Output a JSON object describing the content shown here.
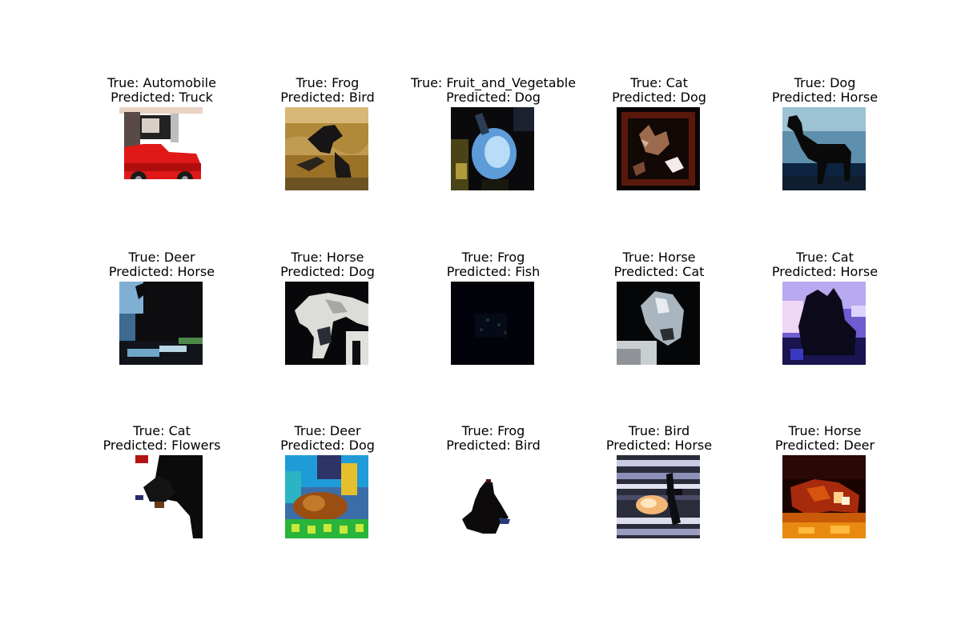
{
  "figure": {
    "panels": [
      {
        "true_label": "True: Automobile",
        "predicted_label": "Predicted: Truck",
        "thumbnail": "red-car-icon"
      },
      {
        "true_label": "True: Frog",
        "predicted_label": "Predicted: Bird",
        "thumbnail": "frog-on-ground-icon"
      },
      {
        "true_label": "True: Fruit_and_Vegetable",
        "predicted_label": "Predicted: Dog",
        "thumbnail": "blue-fruit-icon"
      },
      {
        "true_label": "True: Cat",
        "predicted_label": "Predicted: Dog",
        "thumbnail": "cat-in-frame-icon"
      },
      {
        "true_label": "True: Dog",
        "predicted_label": "Predicted: Horse",
        "thumbnail": "dog-silhouette-icon"
      },
      {
        "true_label": "True: Deer",
        "predicted_label": "Predicted: Horse",
        "thumbnail": "dark-deer-icon"
      },
      {
        "true_label": "True: Horse",
        "predicted_label": "Predicted: Dog",
        "thumbnail": "white-horse-icon"
      },
      {
        "true_label": "True: Frog",
        "predicted_label": "Predicted: Fish",
        "thumbnail": "dark-frog-icon"
      },
      {
        "true_label": "True: Horse",
        "predicted_label": "Predicted: Cat",
        "thumbnail": "horse-head-icon"
      },
      {
        "true_label": "True: Cat",
        "predicted_label": "Predicted: Horse",
        "thumbnail": "cat-purple-icon"
      },
      {
        "true_label": "True: Cat",
        "predicted_label": "Predicted: Flowers",
        "thumbnail": "black-cat-white-icon"
      },
      {
        "true_label": "True: Deer",
        "predicted_label": "Predicted: Dog",
        "thumbnail": "deer-colorful-icon"
      },
      {
        "true_label": "True: Frog",
        "predicted_label": "Predicted: Bird",
        "thumbnail": "frog-silhouette-icon"
      },
      {
        "true_label": "True: Bird",
        "predicted_label": "Predicted: Horse",
        "thumbnail": "bird-striped-icon"
      },
      {
        "true_label": "True: Horse",
        "predicted_label": "Predicted: Deer",
        "thumbnail": "horse-fire-icon"
      }
    ]
  }
}
